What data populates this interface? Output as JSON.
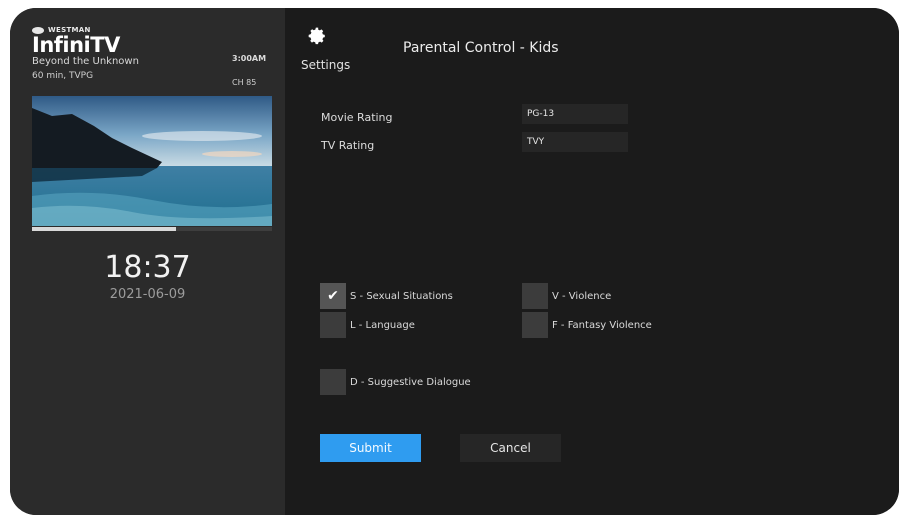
{
  "brand": {
    "maker": "WESTMAN",
    "logo_prefix": "Infini",
    "logo_suffix": "TV"
  },
  "now_playing": {
    "title": "Beyond the Unknown",
    "meta": "60 min, TVPG",
    "time": "3:00AM",
    "channel": "CH 85",
    "progress": 0.6
  },
  "clock": {
    "time": "18:37",
    "date": "2021-06-09"
  },
  "settings": {
    "icon": "gear-icon",
    "label": "Settings"
  },
  "page": {
    "title": "Parental Control - Kids"
  },
  "ratings": {
    "movie_label": "Movie Rating",
    "movie_value": "PG-13",
    "tv_label": "TV Rating",
    "tv_value": "TVY"
  },
  "content_flags": [
    {
      "label": "S - Sexual Situations",
      "checked": true
    },
    {
      "label": "V - Violence",
      "checked": false
    },
    {
      "label": "L - Language",
      "checked": false
    },
    {
      "label": "F - Fantasy Violence",
      "checked": false
    },
    {
      "label": "D - Suggestive Dialogue",
      "checked": false
    }
  ],
  "buttons": {
    "submit": "Submit",
    "cancel": "Cancel"
  },
  "colors": {
    "accent": "#2f9cf0",
    "panel": "#2b2b2b",
    "background": "#1b1b1b"
  }
}
